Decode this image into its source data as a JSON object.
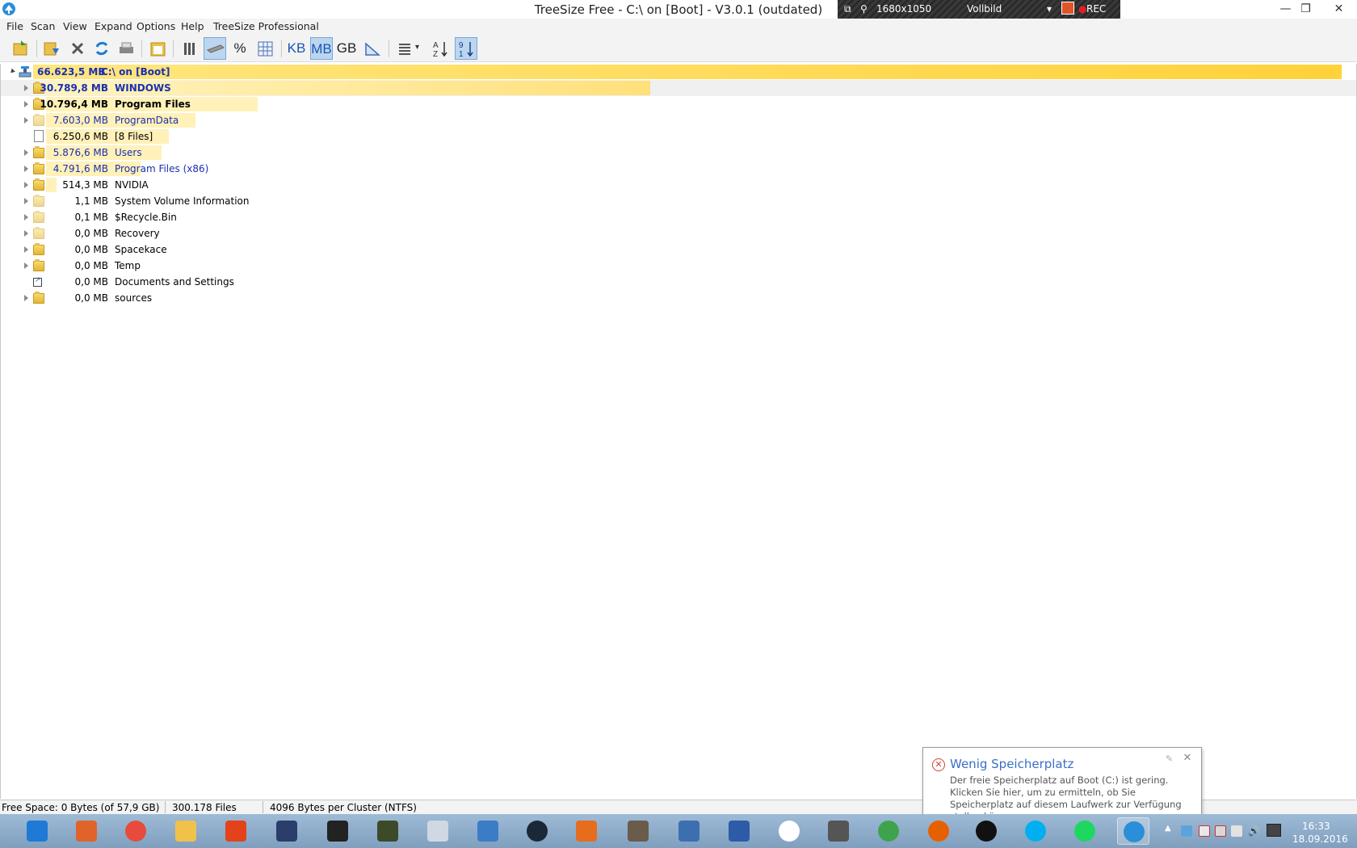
{
  "window": {
    "title": "TreeSize Free - C:\\  on  [Boot] - V3.0.1 (outdated)",
    "recorder": {
      "resolution": "1680x1050",
      "mode": "Vollbild",
      "rec": "REC"
    },
    "minimize_glyph": "—",
    "restore_glyph": "❐",
    "close_glyph": "✕"
  },
  "menu": [
    "File",
    "Scan",
    "View",
    "Expand",
    "Options",
    "Help",
    "TreeSize Professional"
  ],
  "toolbar": {
    "units": [
      "KB",
      "MB",
      "GB"
    ],
    "percent": "%",
    "active_unit": "MB"
  },
  "tree": {
    "root": {
      "size": "66.623,5 MB",
      "name": "C:\\  on  [Boot]",
      "fraction": 1.0
    },
    "items": [
      {
        "size": "30.789,8 MB",
        "name": "WINDOWS",
        "fraction": 0.462,
        "type": "folder",
        "style": "bold-blue",
        "expandable": true
      },
      {
        "size": "10.796,4 MB",
        "name": "Program Files",
        "fraction": 0.162,
        "type": "folder",
        "style": "bold",
        "expandable": true
      },
      {
        "size": "7.603,0 MB",
        "name": "ProgramData",
        "fraction": 0.114,
        "type": "folder-hidden",
        "style": "blue",
        "expandable": true
      },
      {
        "size": "6.250,6 MB",
        "name": "[8 Files]",
        "fraction": 0.094,
        "type": "file",
        "style": "normal",
        "expandable": false
      },
      {
        "size": "5.876,6 MB",
        "name": "Users",
        "fraction": 0.088,
        "type": "folder",
        "style": "blue",
        "expandable": true
      },
      {
        "size": "4.791,6 MB",
        "name": "Program Files (x86)",
        "fraction": 0.072,
        "type": "folder",
        "style": "blue",
        "expandable": true
      },
      {
        "size": "514,3 MB",
        "name": "NVIDIA",
        "fraction": 0.008,
        "type": "folder",
        "style": "normal",
        "expandable": true
      },
      {
        "size": "1,1 MB",
        "name": "System Volume Information",
        "fraction": 0.0,
        "type": "folder-hidden",
        "style": "normal",
        "expandable": true
      },
      {
        "size": "0,1 MB",
        "name": "$Recycle.Bin",
        "fraction": 0.0,
        "type": "folder-hidden",
        "style": "normal",
        "expandable": true
      },
      {
        "size": "0,0 MB",
        "name": "Recovery",
        "fraction": 0.0,
        "type": "folder-hidden",
        "style": "normal",
        "expandable": true
      },
      {
        "size": "0,0 MB",
        "name": "Spacekace",
        "fraction": 0.0,
        "type": "folder",
        "style": "normal",
        "expandable": true
      },
      {
        "size": "0,0 MB",
        "name": "Temp",
        "fraction": 0.0,
        "type": "folder",
        "style": "normal",
        "expandable": true
      },
      {
        "size": "0,0 MB",
        "name": "Documents and Settings",
        "fraction": 0.0,
        "type": "shortcut",
        "style": "normal",
        "expandable": false
      },
      {
        "size": "0,0 MB",
        "name": "sources",
        "fraction": 0.0,
        "type": "folder",
        "style": "normal",
        "expandable": true
      }
    ]
  },
  "status": {
    "free_space": "Free Space: 0 Bytes  (of 57,9 GB)",
    "files": "300.178  Files",
    "cluster": "4096 Bytes per Cluster (NTFS)"
  },
  "notification": {
    "title": "Wenig Speicherplatz",
    "body": "Der freie Speicherplatz auf Boot (C:) ist gering. Klicken Sie hier, um zu ermitteln, ob Sie Speicherplatz auf diesem Laufwerk zur Verfügung stellen können.",
    "close_glyph": "✕"
  },
  "taskbar": {
    "apps": [
      {
        "name": "internet-explorer",
        "color": "#1e7ad6"
      },
      {
        "name": "office-tools",
        "color": "#e0642a"
      },
      {
        "name": "chrome",
        "color": "#e84b3c"
      },
      {
        "name": "file-explorer",
        "color": "#f0c24b"
      },
      {
        "name": "office",
        "color": "#e3421b"
      },
      {
        "name": "app-d",
        "color": "#2b3d6b"
      },
      {
        "name": "color-app",
        "color": "#222222"
      },
      {
        "name": "gta-v",
        "color": "#3d4a2a"
      },
      {
        "name": "monitor-app",
        "color": "#cfd8e3"
      },
      {
        "name": "control-panel",
        "color": "#3b7cc6"
      },
      {
        "name": "steam",
        "color": "#1b2838"
      },
      {
        "name": "media-player",
        "color": "#e66d1e"
      },
      {
        "name": "gimp",
        "color": "#6b5b4a"
      },
      {
        "name": "fallout-shelter",
        "color": "#3c6fb0"
      },
      {
        "name": "pen-app",
        "color": "#2e5ba8"
      },
      {
        "name": "steelseries",
        "color": "#ffffff"
      },
      {
        "name": "device-app",
        "color": "#555555"
      },
      {
        "name": "green-globe",
        "color": "#3fa34d"
      },
      {
        "name": "firefox",
        "color": "#e66000"
      },
      {
        "name": "recorder",
        "color": "#111111"
      },
      {
        "name": "skype",
        "color": "#00aff0"
      },
      {
        "name": "spotify",
        "color": "#1ed760"
      },
      {
        "name": "treesize",
        "color": "#2a8ed8"
      }
    ],
    "active_app": "treesize",
    "clock_time": "16:33",
    "clock_date": "18.09.2016"
  }
}
